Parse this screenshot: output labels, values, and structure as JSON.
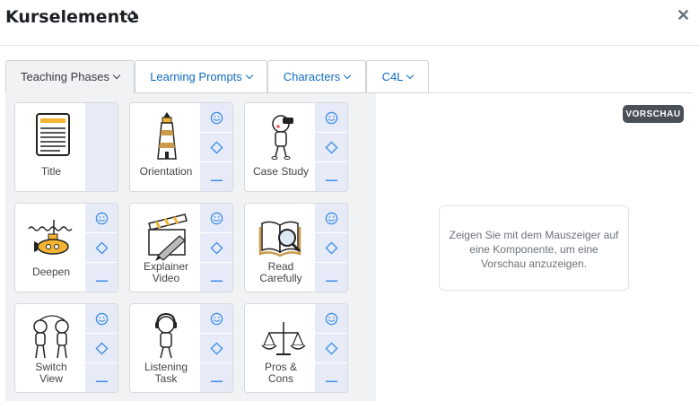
{
  "header": {
    "title": "Kurselemente",
    "settings_icon": "gear-icon",
    "close_label": "✕"
  },
  "tabs": [
    {
      "label": "Teaching Phases",
      "active": true
    },
    {
      "label": "Learning Prompts",
      "active": false
    },
    {
      "label": "Characters",
      "active": false
    },
    {
      "label": "C4L",
      "active": false
    }
  ],
  "cards": [
    {
      "label": "Title",
      "icon": "document-icon"
    },
    {
      "label": "Orientation",
      "icon": "lighthouse-icon"
    },
    {
      "label": "Case Study",
      "icon": "figure-binoculars-icon"
    },
    {
      "label": "Deepen",
      "icon": "submarine-icon"
    },
    {
      "label": "Explainer\nVideo",
      "icon": "clapperboard-icon"
    },
    {
      "label": "Read\nCarefully",
      "icon": "book-magnifier-icon"
    },
    {
      "label": "Switch\nView",
      "icon": "two-figures-icon"
    },
    {
      "label": "Listening\nTask",
      "icon": "figure-headphones-icon"
    },
    {
      "label": "Pros &\nCons",
      "icon": "scales-icon"
    }
  ],
  "preview": {
    "badge": "VORSCHAU",
    "hint": "Zeigen Sie mit dem Mauszeiger auf eine Komponente, um eine Vorschau anzuzeigen."
  },
  "colors": {
    "accent": "#0f6cbf",
    "side_bg": "#e6ebf7",
    "side_icon": "#3d8ce8"
  }
}
